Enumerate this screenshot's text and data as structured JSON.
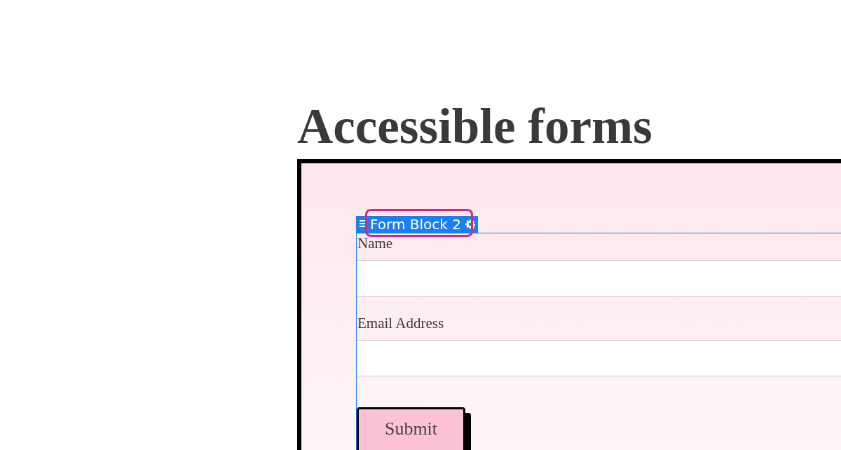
{
  "heading": "Accessible forms",
  "form_block": {
    "tag": {
      "label": "Form Block 2",
      "highlighted": true
    },
    "fields": [
      {
        "label": "Name"
      },
      {
        "label": "Email Address"
      }
    ],
    "submit_button": "Submit"
  }
}
